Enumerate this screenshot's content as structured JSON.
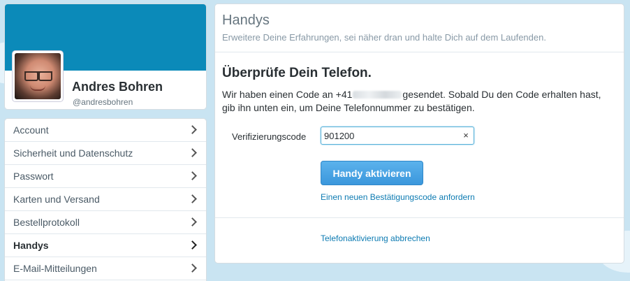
{
  "profile": {
    "name": "Andres Bohren",
    "handle": "@andresbohren"
  },
  "sidebar": {
    "items": [
      {
        "label": "Account"
      },
      {
        "label": "Sicherheit und Datenschutz"
      },
      {
        "label": "Passwort"
      },
      {
        "label": "Karten und Versand"
      },
      {
        "label": "Bestellprotokoll"
      },
      {
        "label": "Handys",
        "active": true
      },
      {
        "label": "E-Mail-Mitteilungen"
      }
    ]
  },
  "main": {
    "title": "Handys",
    "subtitle": "Erweitere Deine Erfahrungen, sei näher dran und halte Dich auf dem Laufenden.",
    "verify_heading": "Überprüfe Dein Telefon.",
    "verify_text_before": "Wir haben einen Code an +41",
    "verify_text_after": "gesendet. Sobald Du den Code erhalten hast, gib ihn unten ein, um Deine Telefonnummer zu bestätigen.",
    "code_label": "Verifizierungscode",
    "code_value": "901200",
    "clear_symbol": "×",
    "activate_label": "Handy aktivieren",
    "new_code_link": "Einen neuen Bestätigungscode anfordern",
    "cancel_link": "Telefonaktivierung abbrechen"
  }
}
